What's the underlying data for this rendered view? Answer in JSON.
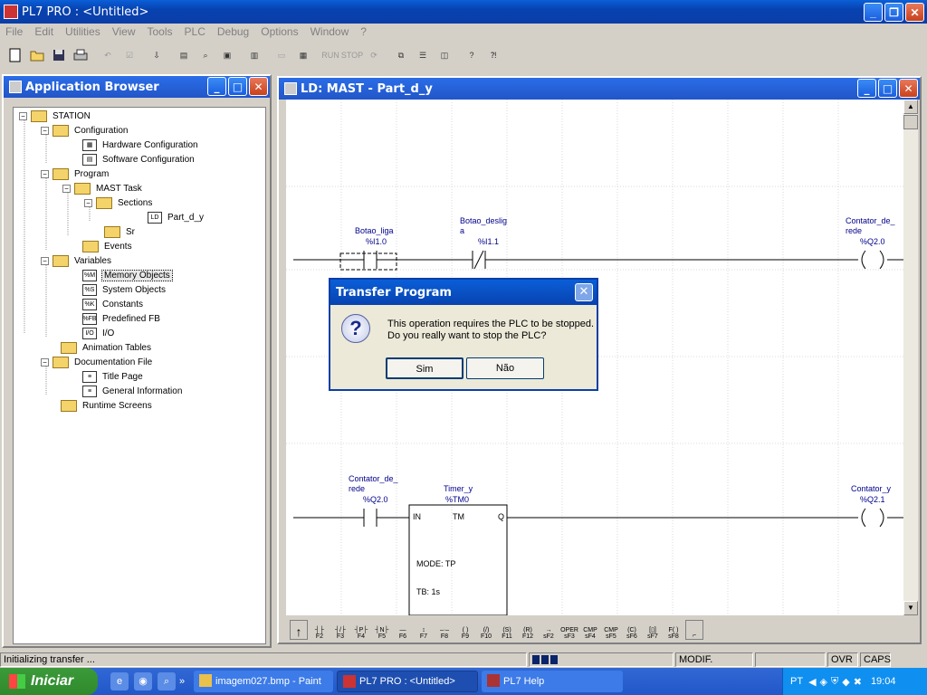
{
  "main_window": {
    "title": "PL7 PRO : <Untitled>"
  },
  "menu": [
    "File",
    "Edit",
    "Utilities",
    "View",
    "Tools",
    "PLC",
    "Debug",
    "Options",
    "Window",
    "?"
  ],
  "toolbar_icons": [
    "new-icon",
    "open-icon",
    "save-icon",
    "print-icon",
    "undo-icon",
    "validate-icon",
    "import-icon",
    "config-icon",
    "find-icon",
    "network-icon",
    "plc-icon",
    "monitor-icon",
    "view-icon",
    "run-icon",
    "stop-icon",
    "init-icon",
    "cascade-icon",
    "tile-h-icon",
    "tile-v-icon",
    "help-icon",
    "context-help-icon"
  ],
  "toolbar_labels": {
    "run": "RUN",
    "stop": "STOP"
  },
  "app_browser": {
    "title": "Application Browser",
    "tree": [
      {
        "label": "STATION",
        "icon": "folder"
      },
      {
        "label": "Configuration",
        "icon": "folder"
      },
      {
        "label": "Hardware Configuration",
        "icon": "hardware"
      },
      {
        "label": "Software Configuration",
        "icon": "software"
      },
      {
        "label": "Program",
        "icon": "folder"
      },
      {
        "label": "MAST Task",
        "icon": "folder"
      },
      {
        "label": "Sections",
        "icon": "folder"
      },
      {
        "label": "Part_d_y",
        "icon": "ld"
      },
      {
        "label": "Sr",
        "icon": "folder"
      },
      {
        "label": "Events",
        "icon": "folder"
      },
      {
        "label": "Variables",
        "icon": "folder"
      },
      {
        "label": "Memory Objects",
        "icon": "%M"
      },
      {
        "label": "System Objects",
        "icon": "%S"
      },
      {
        "label": "Constants",
        "icon": "%K"
      },
      {
        "label": "Predefined FB",
        "icon": "%FB"
      },
      {
        "label": "I/O",
        "icon": "I/O"
      },
      {
        "label": "Animation Tables",
        "icon": "folder"
      },
      {
        "label": "Documentation File",
        "icon": "folder"
      },
      {
        "label": "Title Page",
        "icon": "doc"
      },
      {
        "label": "General Information",
        "icon": "doc"
      },
      {
        "label": "Runtime Screens",
        "icon": "folder"
      }
    ]
  },
  "ld_window": {
    "title": "LD: MAST - Part_d_y",
    "rung1": {
      "contact1": {
        "name": "Botao_liga",
        "addr": "%I1.0"
      },
      "contact2": {
        "name_line1": "Botao_deslig",
        "name_line2": "a",
        "addr": "%I1.1"
      },
      "coil": {
        "name_line1": "Contator_de_",
        "name_line2": "rede",
        "addr": "%Q2.0"
      }
    },
    "rung2": {
      "contact": {
        "name_line1": "Contator_de_",
        "name_line2": "rede",
        "addr": "%Q2.0"
      },
      "timer": {
        "name": "Timer_y",
        "addr": "%TM0",
        "in": "IN",
        "tm": "TM",
        "q": "Q",
        "mode": "MODE: TP",
        "tb": "TB: 1s"
      },
      "coil": {
        "name": "Contator_y",
        "addr": "%Q2.1"
      }
    },
    "palette_keys": [
      "F2",
      "F3",
      "F4",
      "F5",
      "F6",
      "F7",
      "F8",
      "F9",
      "F10",
      "F11",
      "F12",
      "sF2",
      "sF3",
      "sF4",
      "sF5",
      "sF6",
      "sF7",
      "sF8"
    ]
  },
  "dialog": {
    "title": "Transfer Program",
    "line1": "This operation requires the PLC to be stopped.",
    "line2": "Do you really want to stop the PLC?",
    "yes": "Sim",
    "no": "Não"
  },
  "statusbar": {
    "message": "Initializing transfer ...",
    "mode": "MODIF.",
    "ovr": "OVR",
    "caps": "CAPS"
  },
  "taskbar": {
    "start": "Iniciar",
    "tasks": [
      "imagem027.bmp - Paint",
      "PL7 PRO : <Untitled>",
      "PL7 Help"
    ],
    "lang": "PT",
    "clock": "19:04"
  }
}
